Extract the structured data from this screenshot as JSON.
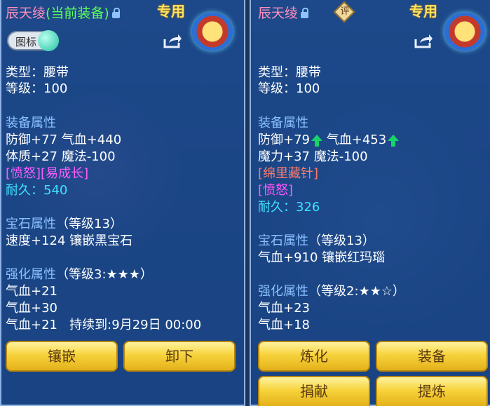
{
  "left": {
    "name": "辰天绫",
    "name_note": "(当前装备)",
    "tag": "专用",
    "icon_toggle_label": "图标",
    "type_line": "类型：腰带",
    "level_line": "等级：100",
    "equip_header": "装备属性",
    "attr1": "防御+77 气血+440",
    "attr2": "体质+27 魔法-100",
    "special": "[愤怒][易成长]",
    "durability_label": "耐久：",
    "durability_value": "540",
    "gem_header": "宝石属性",
    "gem_level": "（等级13）",
    "gem_attr": "速度+124 镶嵌黑宝石",
    "strength_header": "强化属性",
    "strength_level": "（等级3:★★★）",
    "s1": "气血+21",
    "s2": "气血+30",
    "s3": "气血+21",
    "s3_duration": "持续到:9月29日 00:00",
    "btn_inlay": "镶嵌",
    "btn_unequip": "卸下"
  },
  "right": {
    "name": "辰天绫",
    "badge": "评",
    "tag": "专用",
    "type_line": "类型：腰带",
    "level_line": "等级：100",
    "equip_header": "装备属性",
    "attr1a": "防御+79",
    "attr1b": "气血+453",
    "attr2": "魔力+37 魔法-100",
    "special1": "[绵里藏针]",
    "special2": "[愤怒]",
    "durability_label": "耐久：",
    "durability_value": "326",
    "gem_header": "宝石属性",
    "gem_level": "（等级13）",
    "gem_attr": "气血+910 镶嵌红玛瑙",
    "strength_header": "强化属性",
    "strength_level": "（等级2:★★☆）",
    "s1": "气血+23",
    "s2": "气血+18",
    "btn_refine": "炼化",
    "btn_equip": "装备",
    "btn_donate": "捐献",
    "btn_extract": "提炼"
  }
}
